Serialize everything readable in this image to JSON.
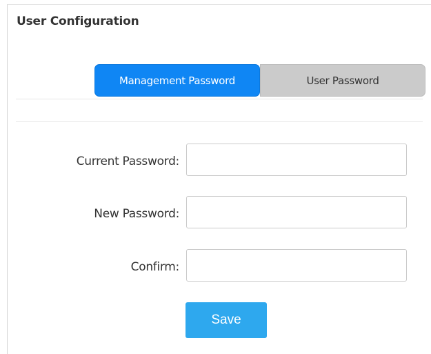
{
  "page": {
    "title": "User Configuration"
  },
  "tabs": [
    {
      "label": "Management Password",
      "active": true
    },
    {
      "label": "User Password",
      "active": false
    }
  ],
  "form": {
    "current_password": {
      "label": "Current Password:",
      "value": "",
      "placeholder": ""
    },
    "new_password": {
      "label": "New Password:",
      "value": "",
      "placeholder": ""
    },
    "confirm": {
      "label": "Confirm:",
      "value": "",
      "placeholder": ""
    },
    "save_label": "Save"
  },
  "colors": {
    "active_tab": "#0f86f4",
    "inactive_tab": "#cbcbcb",
    "save_button": "#2ea8ee"
  }
}
